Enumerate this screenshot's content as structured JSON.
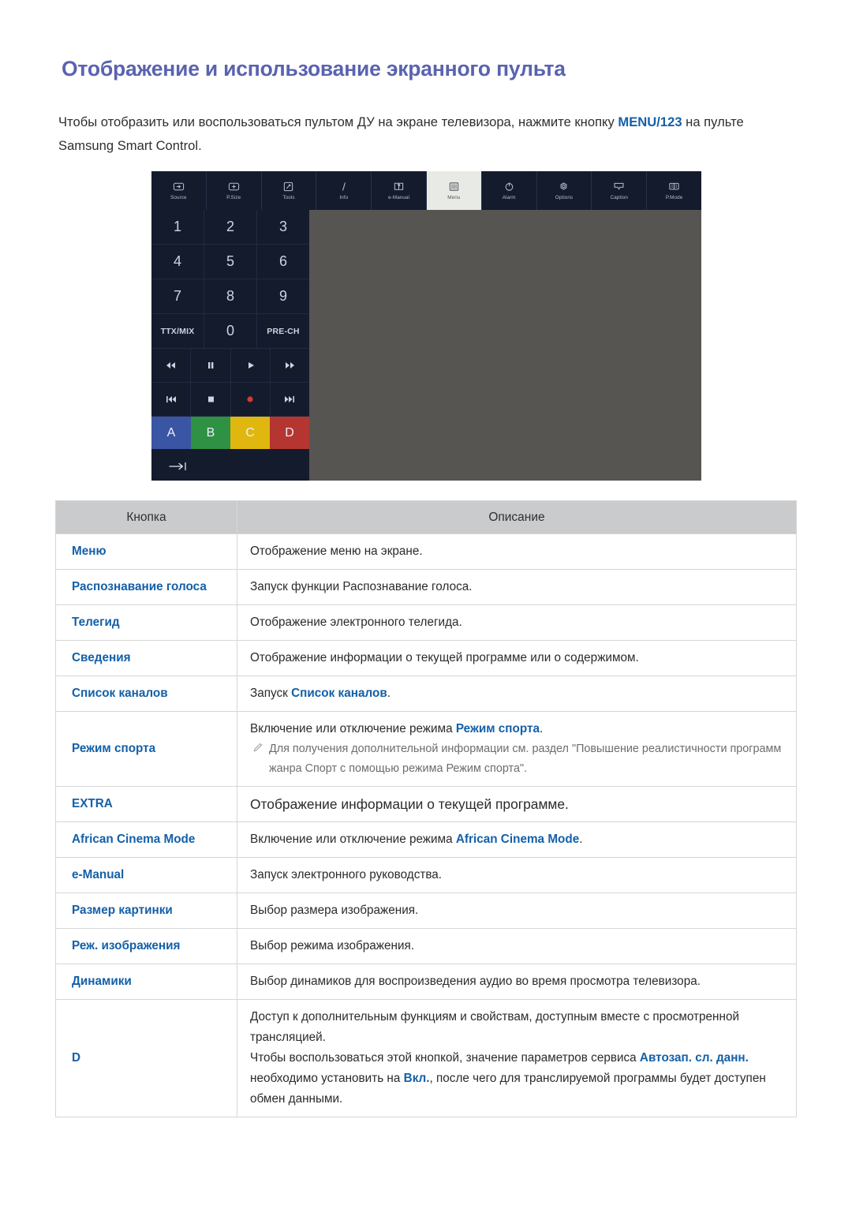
{
  "document": {
    "title": "Отображение и использование экранного пульта",
    "intro_before": "Чтобы отобразить или воспользоваться пультом ДУ на экране телевизора, нажмите кнопку ",
    "intro_link": "MENU/123",
    "intro_after": " на пульте Samsung Smart Control."
  },
  "colors": {
    "heading": "#5A63AF",
    "link": "#1460A8",
    "remote_panel": "#141B2D",
    "remote_screen": "#575552",
    "table_header_bg": "#c9cbcd",
    "color_a": "#3B55A5",
    "color_b": "#2E9144",
    "color_c": "#DFB70E",
    "color_d": "#B53630"
  },
  "remote": {
    "toolbar": [
      {
        "label": "Source",
        "icon": "source-icon",
        "active": false
      },
      {
        "label": "P.Size",
        "icon": "picture-size-icon",
        "active": false
      },
      {
        "label": "Tools",
        "icon": "tools-icon",
        "active": false
      },
      {
        "label": "Info",
        "icon": "info-icon",
        "active": false
      },
      {
        "label": "e-Manual",
        "icon": "e-manual-icon",
        "active": false
      },
      {
        "label": "Menu",
        "icon": "menu-icon",
        "active": true
      },
      {
        "label": "Alarm",
        "icon": "alarm-power-icon",
        "active": false
      },
      {
        "label": "Options",
        "icon": "options-gear-icon",
        "active": false
      },
      {
        "label": "Caption",
        "icon": "caption-icon",
        "active": false
      },
      {
        "label": "P.Mode",
        "icon": "picture-mode-icon",
        "active": false
      }
    ],
    "keypad": [
      [
        "1",
        "2",
        "3"
      ],
      [
        "4",
        "5",
        "6"
      ],
      [
        "7",
        "8",
        "9"
      ],
      [
        "TTX/MIX",
        "0",
        "PRE-CH"
      ]
    ],
    "media_row_1": [
      "rewind-icon",
      "pause-icon",
      "play-icon",
      "fast-forward-icon"
    ],
    "media_row_2": [
      "skip-back-icon",
      "stop-icon",
      "record-icon",
      "skip-forward-icon"
    ],
    "color_buttons": [
      "A",
      "B",
      "C",
      "D"
    ],
    "bottom_button": "jump-to-icon"
  },
  "table": {
    "headers": [
      "Кнопка",
      "Описание"
    ],
    "rows": [
      {
        "button": "Меню",
        "desc_parts": [
          {
            "t": "Отображение меню на экране.",
            "link": false
          }
        ]
      },
      {
        "button": "Распознавание голоса",
        "desc_parts": [
          {
            "t": "Запуск функции Распознавание голоса.",
            "link": false
          }
        ]
      },
      {
        "button": "Телегид",
        "desc_parts": [
          {
            "t": "Отображение электронного телегида.",
            "link": false
          }
        ]
      },
      {
        "button": "Сведения",
        "desc_parts": [
          {
            "t": "Отображение информации о текущей программе или о содержимом.",
            "link": false
          }
        ]
      },
      {
        "button": "Список каналов",
        "desc_parts": [
          {
            "t": "Запуск ",
            "link": false
          },
          {
            "t": "Список каналов",
            "link": true
          },
          {
            "t": ".",
            "link": false
          }
        ]
      },
      {
        "button": "Режим спорта",
        "desc_parts": [
          {
            "t": "Включение или отключение режима ",
            "link": false
          },
          {
            "t": "Режим спорта",
            "link": true
          },
          {
            "t": ".",
            "link": false
          }
        ],
        "note": "Для получения дополнительной информации см. раздел \"Повышение реалистичности программ жанра Спорт с помощью режима Режим спорта\"."
      },
      {
        "button": "EXTRA",
        "large": true,
        "desc_parts": [
          {
            "t": "Отображение информации о текущей программе.",
            "link": false
          }
        ]
      },
      {
        "button": "African Cinema Mode",
        "desc_parts": [
          {
            "t": "Включение или отключение режима ",
            "link": false
          },
          {
            "t": "African Cinema Mode",
            "link": true
          },
          {
            "t": ".",
            "link": false
          }
        ]
      },
      {
        "button": "e-Manual",
        "desc_parts": [
          {
            "t": "Запуск электронного руководства.",
            "link": false
          }
        ]
      },
      {
        "button": "Размер картинки",
        "desc_parts": [
          {
            "t": "Выбор размера изображения.",
            "link": false
          }
        ]
      },
      {
        "button": "Реж. изображения",
        "desc_parts": [
          {
            "t": "Выбор режима изображения.",
            "link": false
          }
        ]
      },
      {
        "button": "Динамики",
        "desc_parts": [
          {
            "t": "Выбор динамиков для воспроизведения аудио во время просмотра телевизора.",
            "link": false
          }
        ]
      },
      {
        "button": "D",
        "desc_parts": [
          {
            "t": "Доступ к дополнительным функциям и свойствам, доступным вместе с просмотренной трансляцией.",
            "link": false
          },
          {
            "t": "\n",
            "link": false
          },
          {
            "t": "Чтобы воспользоваться этой кнопкой, значение параметров сервиса ",
            "link": false
          },
          {
            "t": "Автозап. сл. данн.",
            "link": true
          },
          {
            "t": " необходимо установить на ",
            "link": false
          },
          {
            "t": "Вкл.",
            "link": true
          },
          {
            "t": ", после чего для транслируемой программы будет доступен обмен данными.",
            "link": false
          }
        ]
      }
    ]
  }
}
